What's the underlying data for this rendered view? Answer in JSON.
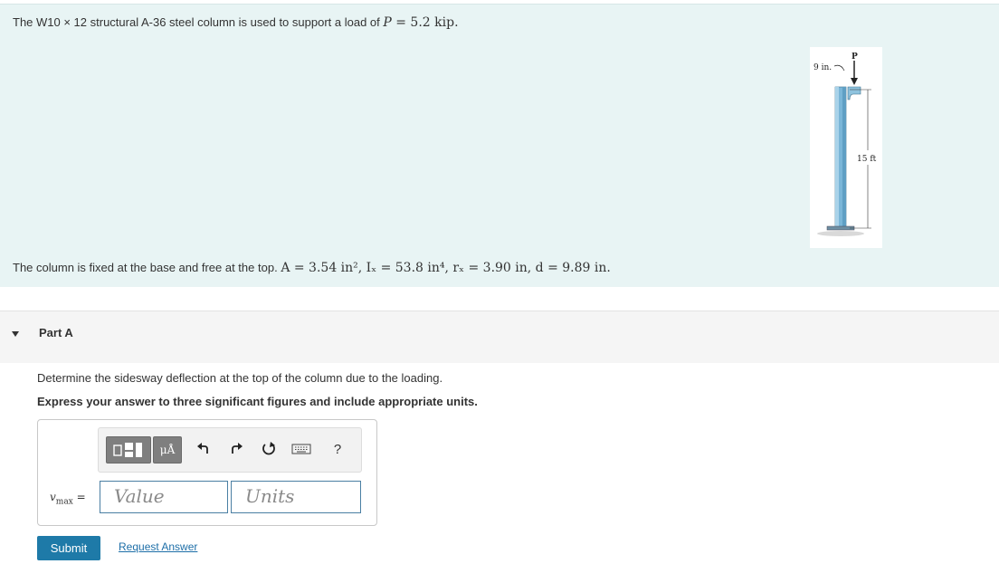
{
  "problem": {
    "intro_text": "The W10 × 12 structural A-36 steel column is used to support a load of",
    "intro_var": "P",
    "intro_value": "= 5.2 kip.",
    "statement_text": "The column is fixed at the base and free at the top.",
    "statement_math": "A = 3.54 in², Iₓ = 53.8 in⁴, rₓ = 3.90 in, d = 9.89 in."
  },
  "figure": {
    "load_label": "P",
    "offset_label": "9 in.",
    "height_label": "15 ft"
  },
  "part": {
    "title": "Part A",
    "question": "Determine the sidesway deflection at the top of the column due to the loading.",
    "instruction": "Express your answer to three significant figures and include appropriate units."
  },
  "answer": {
    "variable": "v",
    "subscript": "max",
    "equals": "=",
    "value_placeholder": "Value",
    "units_placeholder": "Units"
  },
  "toolbar": {
    "units_label": "μÅ",
    "undo_icon": "undo-icon",
    "redo_icon": "redo-icon",
    "reset_icon": "reset-icon",
    "keyboard_icon": "keyboard-icon",
    "help_label": "?"
  },
  "actions": {
    "submit_label": "Submit",
    "request_label": "Request Answer"
  },
  "colors": {
    "problem_bg": "#e8f4f4",
    "accent": "#1e7aa8",
    "column_blue": "#7ab6d8"
  }
}
